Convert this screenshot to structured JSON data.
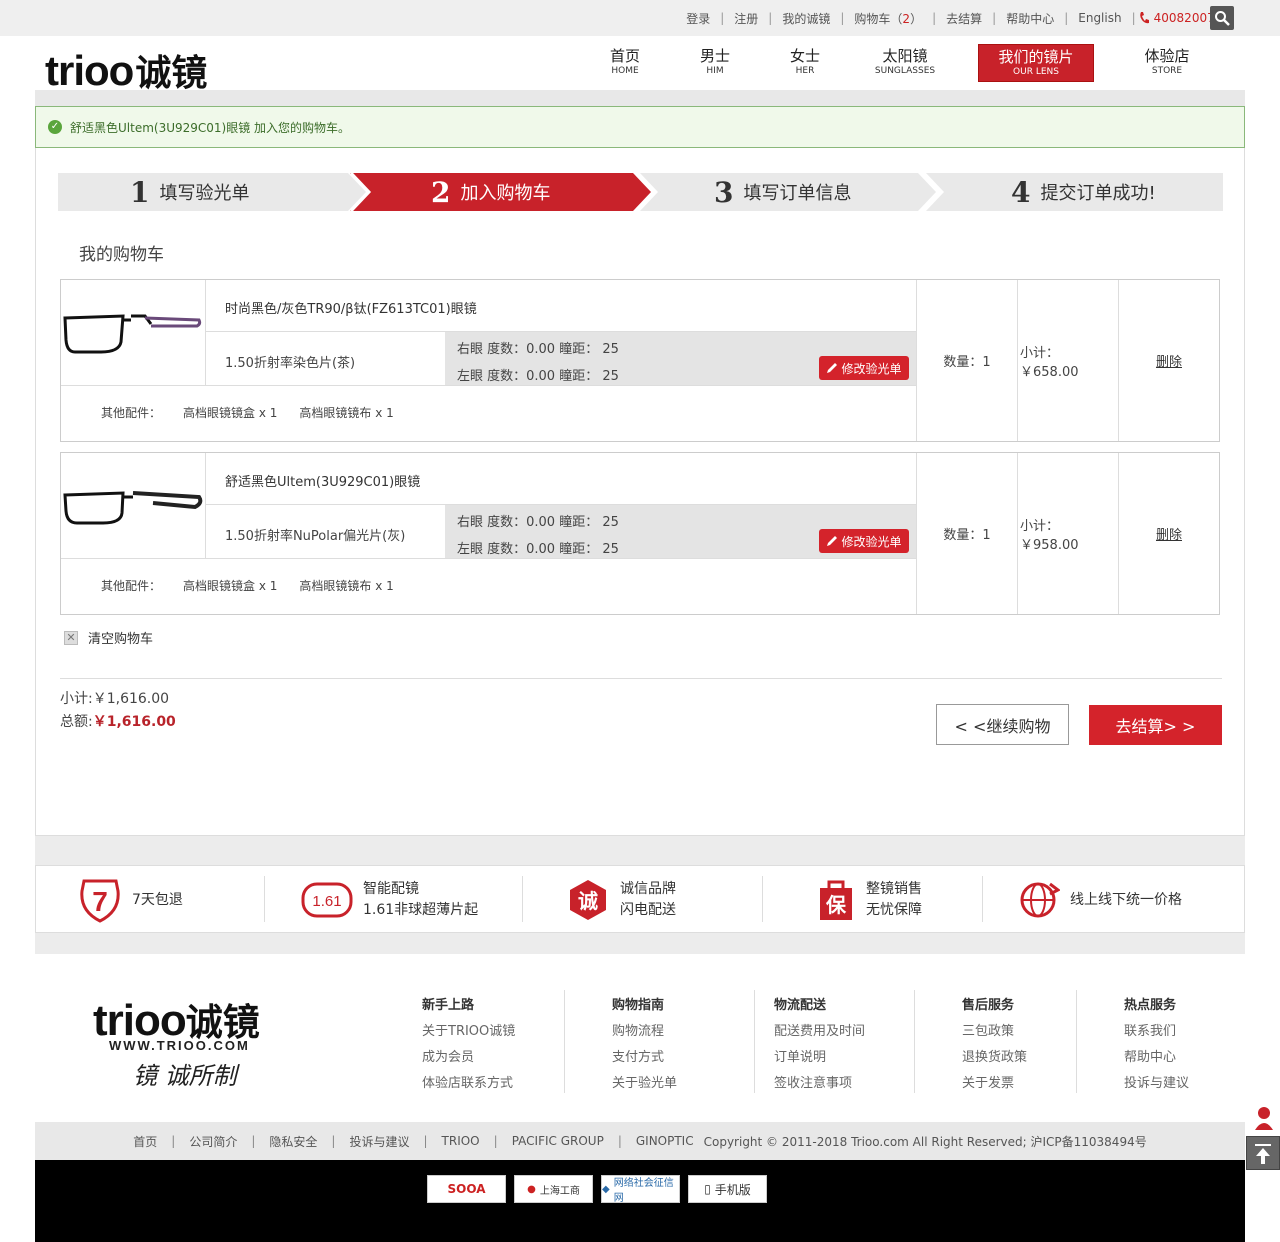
{
  "topbar": {
    "links": [
      "登录",
      "注册",
      "我的诚镜",
      "购物车（",
      "2",
      "）",
      "去结算",
      "帮助中心",
      "English"
    ],
    "phone": "4008200750"
  },
  "header": {
    "logo_en": "trioo",
    "logo_cn": "诚镜",
    "nav": [
      {
        "zh": "首页",
        "en": "HOME"
      },
      {
        "zh": "男士",
        "en": "HIM"
      },
      {
        "zh": "女士",
        "en": "HER"
      },
      {
        "zh": "太阳镜",
        "en": "SUNGLASSES"
      },
      {
        "zh": "我们的镜片",
        "en": "OUR LENS"
      },
      {
        "zh": "体验店",
        "en": "STORE"
      }
    ]
  },
  "notice": "舒适黑色Ultem(3U929C01)眼镜 加入您的购物车。",
  "steps": [
    {
      "num": "1",
      "label": "填写验光单"
    },
    {
      "num": "2",
      "label": "加入购物车"
    },
    {
      "num": "3",
      "label": "填写订单信息"
    },
    {
      "num": "4",
      "label": "提交订单成功!"
    }
  ],
  "cart_title": "我的购物车",
  "items": [
    {
      "name": "时尚黑色/灰色TR90/β钛(FZ613TC01)眼镜",
      "lens": "1.50折射率染色片(茶)",
      "right_eye": "右眼 度数：0.00    瞳距： 25",
      "left_eye": "左眼 度数：0.00    瞳距： 25",
      "modify": "修改验光单",
      "extras_label": "其他配件：",
      "extra1": "高档眼镜镜盒 x 1",
      "extra2": "高档眼镜镜布 x 1",
      "qty": "数量：1",
      "subtotal": "小计： ￥658.00",
      "delete": "删除"
    },
    {
      "name": "舒适黑色Ultem(3U929C01)眼镜",
      "lens": "1.50折射率NuPolar偏光片(灰)",
      "right_eye": "右眼 度数：0.00    瞳距： 25",
      "left_eye": "左眼 度数：0.00    瞳距： 25",
      "modify": "修改验光单",
      "extras_label": "其他配件：",
      "extra1": "高档眼镜镜盒 x 1",
      "extra2": "高档眼镜镜布 x 1",
      "qty": "数量：1",
      "subtotal": "小计： ￥958.00",
      "delete": "删除"
    }
  ],
  "clear_cart": "清空购物车",
  "totals": {
    "subtotal_label": "小计:",
    "subtotal": "￥1,616.00",
    "total_label": "总额:",
    "total": "￥1,616.00"
  },
  "buttons": {
    "continue": "< <继续购物",
    "checkout": "去结算> >"
  },
  "services": [
    {
      "icon": "7",
      "l1": "7天包退",
      "l2": ""
    },
    {
      "icon": "1.61",
      "l1": "智能配镜",
      "l2": "1.61非球超薄片起"
    },
    {
      "icon": "诚",
      "l1": "诚信品牌",
      "l2": "闪电配送"
    },
    {
      "icon": "保",
      "l1": "整镜销售",
      "l2": "无忧保障"
    },
    {
      "icon": "globe",
      "l1": "线上线下统一价格",
      "l2": ""
    }
  ],
  "footer": {
    "logo_url": "WWW.TRIOO.COM",
    "signature": "镜 诚所制",
    "cols": [
      {
        "h": "新手上路",
        "items": [
          "关于TRIOO诚镜",
          "成为会员",
          "体验店联系方式"
        ]
      },
      {
        "h": "购物指南",
        "items": [
          "购物流程",
          "支付方式",
          "关于验光单"
        ]
      },
      {
        "h": "物流配送",
        "items": [
          "配送费用及时间",
          "订单说明",
          "签收注意事项"
        ]
      },
      {
        "h": "售后服务",
        "items": [
          "三包政策",
          "退换货政策",
          "关于发票"
        ]
      },
      {
        "h": "热点服务",
        "items": [
          "联系我们",
          "帮助中心",
          "投诉与建议"
        ]
      }
    ],
    "bottom_links": [
      "首页",
      "公司简介",
      "隐私安全",
      "投诉与建议",
      "TRIOO",
      "PACIFIC GROUP",
      "GINOPTIC"
    ],
    "copyright": "Copyright © 2011-2018 Trioo.com All Right Reserved; 沪ICP备11038494号",
    "badges": [
      "SOOA",
      "上海工商",
      "网络社会征信网",
      "手机版"
    ]
  }
}
